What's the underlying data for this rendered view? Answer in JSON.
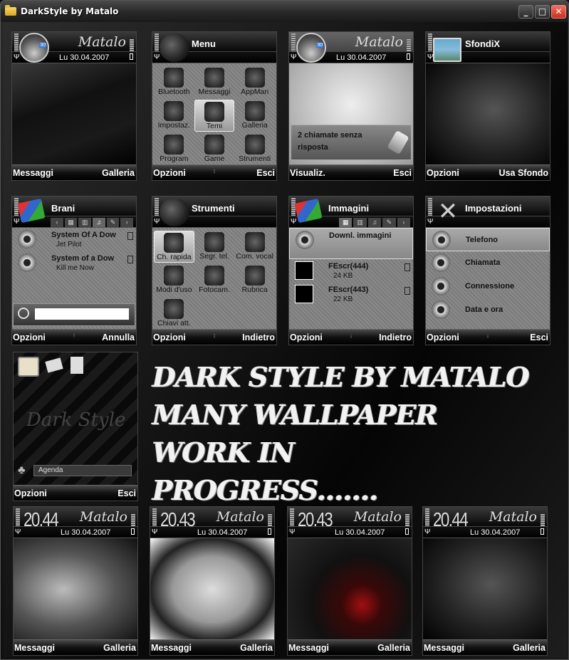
{
  "window": {
    "title": "DarkStyle by Matalo",
    "minimize": "_",
    "maximize": "□",
    "close": "✕"
  },
  "brand": "Matalo",
  "date": "Lu 30.04.2007",
  "phones": {
    "standby1": {
      "left": "Messaggi",
      "right": "Galleria"
    },
    "menu": {
      "title": "Menu",
      "left": "Opzioni",
      "right": "Esci",
      "mid": "↕",
      "items": [
        {
          "label": "Bluetooth",
          "icon": "bluetooth-icon"
        },
        {
          "label": "Messaggi",
          "icon": "envelope-icon"
        },
        {
          "label": "AppMan",
          "icon": "app-manager-icon"
        },
        {
          "label": "Impostaz.",
          "icon": "tools-icon"
        },
        {
          "label": "Temi",
          "icon": "themes-icon",
          "selected": true
        },
        {
          "label": "Galleria",
          "icon": "gallery-icon"
        },
        {
          "label": "Program",
          "icon": "folder-icon"
        },
        {
          "label": "Game",
          "icon": "folder-icon"
        },
        {
          "label": "Strumenti",
          "icon": "folder-icon"
        }
      ]
    },
    "missed": {
      "text1": "2 chiamate senza",
      "text2": "risposta",
      "left": "Visualiz.",
      "right": "Esci"
    },
    "sfondix": {
      "title": "SfondiX",
      "left": "Opzioni",
      "right": "Usa Sfondo"
    },
    "brani": {
      "title": "Brani",
      "left": "Opzioni",
      "right": "Annulla",
      "mid": "↑",
      "tabs": [
        "‹",
        "▦",
        "▥",
        "♫",
        "✎",
        "›"
      ],
      "rows": [
        {
          "title": "System Of A Dow",
          "sub": "Jet Pilot"
        },
        {
          "title": "System of a Dow",
          "sub": "Kill me Now"
        }
      ],
      "search_value": ""
    },
    "strumenti": {
      "title": "Strumenti",
      "left": "Opzioni",
      "right": "Indietro",
      "mid": "↕",
      "items": [
        {
          "label": "Ch. rapida",
          "icon": "speed-dial-icon",
          "selected": true
        },
        {
          "label": "Segr. tel.",
          "icon": "voicemail-icon"
        },
        {
          "label": "Com. vocal",
          "icon": "voice-command-icon"
        },
        {
          "label": "Modi d'uso",
          "icon": "profiles-icon"
        },
        {
          "label": "Fotocam.",
          "icon": "camera-icon"
        },
        {
          "label": "Rubrica",
          "icon": "contacts-icon"
        },
        {
          "label": "Chiavi att.",
          "icon": "activation-keys-icon"
        }
      ]
    },
    "immagini": {
      "title": "Immagini",
      "left": "Opzioni",
      "right": "Indietro",
      "mid": "↓",
      "tabs": [
        "▦",
        "▥",
        "♫",
        "✎",
        "›"
      ],
      "rows": [
        {
          "title": "Downl. immagini",
          "sub": ""
        },
        {
          "title": "FEscr(444)",
          "sub": "24 KB"
        },
        {
          "title": "FEscr(443)",
          "sub": "22 KB"
        }
      ]
    },
    "impostazioni": {
      "title": "Impostazioni",
      "left": "Opzioni",
      "right": "Esci",
      "mid": "↓",
      "rows": [
        {
          "title": "Telefono"
        },
        {
          "title": "Chiamata"
        },
        {
          "title": "Connessione"
        },
        {
          "title": "Data e ora"
        }
      ]
    },
    "active": {
      "watermark": "Dark Style",
      "agenda": "Agenda",
      "left": "Opzioni",
      "right": "Esci"
    },
    "b1": {
      "time": "20.44",
      "left": "Messaggi",
      "right": "Galleria"
    },
    "b2": {
      "time": "20.43",
      "left": "Messaggi",
      "right": "Galleria"
    },
    "b3": {
      "time": "20.43",
      "left": "Messaggi",
      "right": "Galleria"
    },
    "b4": {
      "time": "20.44",
      "left": "Messaggi",
      "right": "Galleria"
    }
  },
  "banner": {
    "line1": "Dark Style by Matalo",
    "line2": "Many wallpaper work  in",
    "line3": "progress......."
  }
}
